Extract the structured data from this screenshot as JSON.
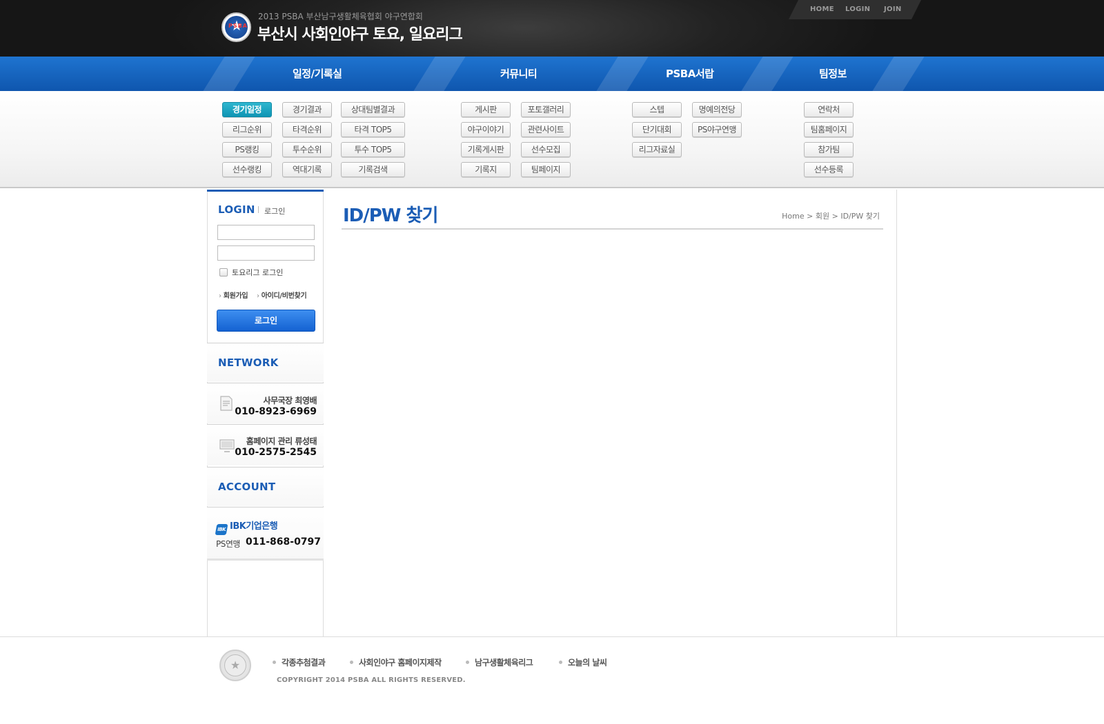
{
  "header": {
    "subtitle": "2013 PSBA 부산남구생활체육협회 야구연합회",
    "title": "부산시 사회인야구 토요, 일요리그",
    "logo_text": "PSBA",
    "util_links": [
      "HOME",
      "LOGIN",
      "JOIN"
    ]
  },
  "nav": {
    "items": [
      "일정/기록실",
      "커뮤니티",
      "PSBA서랍",
      "팀정보"
    ]
  },
  "submenu": {
    "schedule": [
      "경기일정",
      "경기결과",
      "상대팀별결과",
      "리그순위",
      "타격순위",
      "타격 TOP5",
      "PS랭킹",
      "투수순위",
      "투수 TOP5",
      "선수랭킹",
      "역대기록",
      "기록검색"
    ],
    "community": [
      "게시판",
      "포토갤러리",
      "야구이야기",
      "관련사이트",
      "기록게시판",
      "선수모집",
      "기록지",
      "팀페이지"
    ],
    "drawer": [
      "스텝",
      "명예의전당",
      "단기대회",
      "PS야구연맹",
      "리그자료실"
    ],
    "team": [
      "연락처",
      "팀홈페이지",
      "참가팀",
      "선수등록"
    ],
    "active": "경기일정"
  },
  "sidebar": {
    "login": {
      "title": "LOGIN",
      "subtitle": "로그인",
      "id_value": "",
      "pw_value": "",
      "checkbox_label": "토요리그 로그인",
      "checkbox_checked": false,
      "join_link": "회원가입",
      "find_link": "아이디/비번찾기",
      "button": "로그인"
    },
    "network": {
      "title": "NETWORK",
      "contacts": [
        {
          "name": "사무국장 최영배",
          "phone": "010-8923-6969",
          "icon": "document-icon"
        },
        {
          "name": "홈페이지 관리 류성태",
          "phone": "010-2575-2545",
          "icon": "monitor-icon"
        }
      ]
    },
    "account": {
      "title": "ACCOUNT",
      "bank": "IBK기업은행",
      "owner": "PS연맹",
      "number": "011-868-0797"
    }
  },
  "main": {
    "page_title": "ID/PW 찾기",
    "breadcrumb": [
      "Home",
      "회원",
      "ID/PW 찾기"
    ]
  },
  "footer": {
    "links": [
      "각종추첨결과",
      "사회인야구 홈페이지제작",
      "남구생활체육리그",
      "오늘의 날씨"
    ],
    "copyright": "COPYRIGHT 2014 PSBA ALL RIGHTS RESERVED."
  },
  "colors": {
    "accent_blue": "#1b5db5",
    "nav_blue": "#1565c0",
    "active_tab": "#1ea5c2",
    "header_dark": "#1e1e1e"
  }
}
